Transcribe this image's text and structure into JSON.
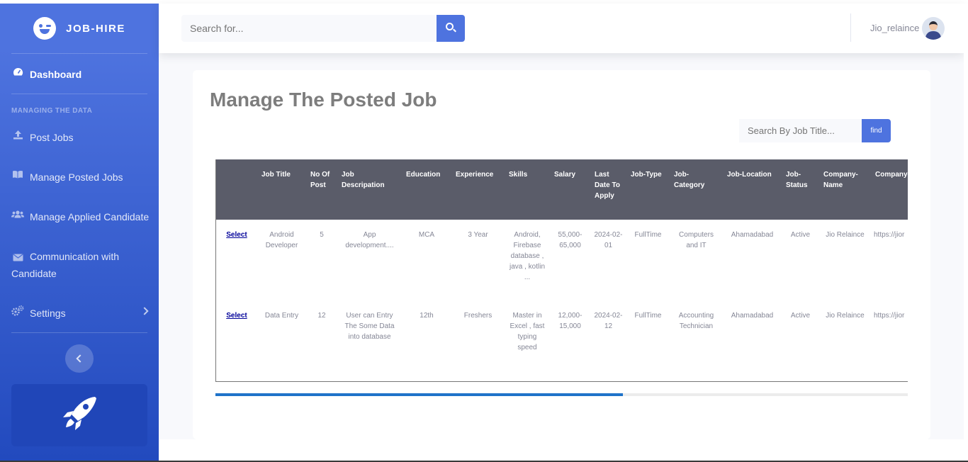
{
  "brand": {
    "name": "JOB-HIRE",
    "icon": "grin-wink-icon"
  },
  "sidebar": {
    "dashboard": {
      "label": "Dashboard",
      "icon": "tachometer-icon"
    },
    "section_heading": "MANAGING THE DATA",
    "items": [
      {
        "label": "Post Jobs",
        "icon": "upload-icon"
      },
      {
        "label": "Manage Posted Jobs",
        "icon": "book-open-icon"
      },
      {
        "label": "Manage Applied Candidate",
        "icon": "users-icon"
      },
      {
        "label": "Communication with Candidate",
        "icon": "envelope-icon"
      },
      {
        "label": "Settings",
        "icon": "cogs-icon"
      }
    ],
    "promo_icon": "rocket-icon"
  },
  "topbar": {
    "search_placeholder": "Search for...",
    "username": "Jio_relaince"
  },
  "main": {
    "title": "Manage The Posted Job",
    "job_search_placeholder": "Search By Job Title...",
    "find_label": "find"
  },
  "table": {
    "columns": [
      "",
      "Job Title",
      "No Of Post",
      "Job Descripation",
      "Education",
      "Experience",
      "Skills",
      "Salary",
      "Last Date To Apply",
      "Job-Type",
      "Job-Category",
      "Job-Location",
      "Job-Status",
      "Company-Name",
      "Company-"
    ],
    "rows": [
      [
        "Select",
        "Android Developer",
        "5",
        "App development....",
        "MCA",
        "3 Year",
        "Android, Firebase database , java , kotlin ...",
        "55,000-65,000",
        "2024-02-01",
        "FullTime",
        "Computers and IT",
        "Ahamadabad",
        "Active",
        "Jio Relaince",
        "https://jior"
      ],
      [
        "Select",
        "Data Entry",
        "12",
        "User can Entry The Some Data into database",
        "12th",
        "Freshers",
        "Master in Excel , fast typing speed",
        "12,000-15,000",
        "2024-02-12",
        "FullTime",
        "Accounting Technician",
        "Ahamadabad",
        "Active",
        "Jio Relaince",
        "https://jior"
      ]
    ]
  },
  "colors": {
    "primary": "#4e73df",
    "sidebar_dark": "#224abe",
    "table_header": "#5a5c69",
    "title_gray": "#7d7d7d",
    "scroll_thumb": "#1f73c9"
  }
}
